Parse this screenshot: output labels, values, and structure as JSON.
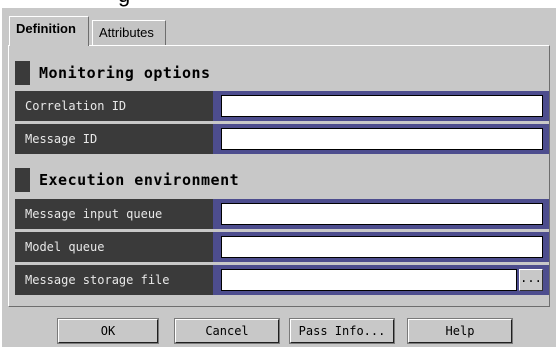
{
  "tabs": [
    {
      "label": "Definition",
      "active": true
    },
    {
      "label": "Attributes",
      "active": false
    }
  ],
  "sections": {
    "monitoring": {
      "title": "Monitoring options",
      "fields": [
        {
          "label": "Correlation ID",
          "value": ""
        },
        {
          "label": "Message ID",
          "value": ""
        }
      ]
    },
    "execution": {
      "title": "Execution environment",
      "fields": [
        {
          "label": "Message input queue",
          "value": ""
        },
        {
          "label": "Model queue",
          "value": ""
        },
        {
          "label": "Message storage file",
          "value": ""
        }
      ],
      "browse_label": "..."
    }
  },
  "buttons": {
    "ok": "OK",
    "cancel": "Cancel",
    "pass_info": "Pass Info...",
    "help": "Help"
  },
  "colors": {
    "dialog_bg": "#c8c8c8",
    "label_bg": "#3a3a3a",
    "input_frame": "#4d4d8e"
  }
}
